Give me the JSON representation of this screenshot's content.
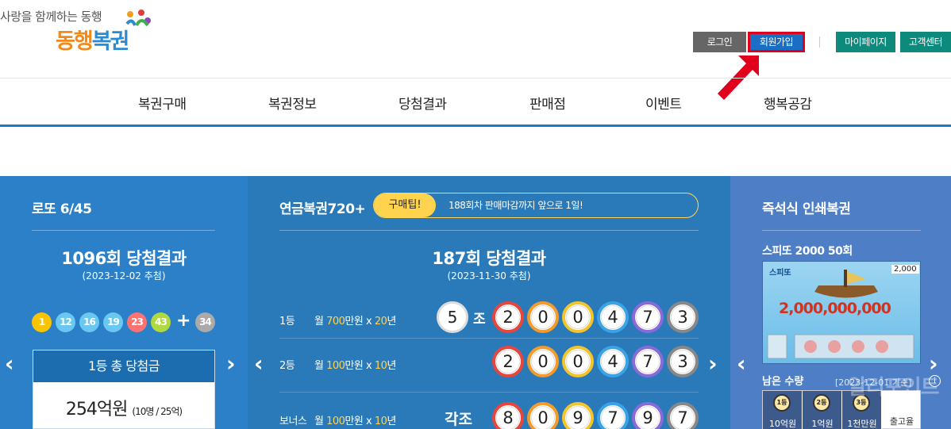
{
  "header": {
    "tagline": "사랑을 함께하는 동행",
    "logo": {
      "part1": "동행",
      "part2": "복권"
    },
    "util": {
      "login": "로그인",
      "join": "회원가입",
      "mypage": "마이페이지",
      "cs": "고객센터"
    },
    "colors": {
      "join_highlight": "#e0001b",
      "arrow": "#e0001b"
    }
  },
  "nav": {
    "items": [
      "복권구매",
      "복권정보",
      "당첨결과",
      "판매점",
      "이벤트",
      "행복공감"
    ]
  },
  "lotto": {
    "title": "로또 6/45",
    "draw_title": "1096회 당첨결과",
    "draw_date": "(2023-12-02 추첨)",
    "balls": [
      {
        "n": "1",
        "color": "#fbc400"
      },
      {
        "n": "12",
        "color": "#69c8f2"
      },
      {
        "n": "16",
        "color": "#69c8f2"
      },
      {
        "n": "19",
        "color": "#69c8f2"
      },
      {
        "n": "23",
        "color": "#ff7272"
      },
      {
        "n": "43",
        "color": "#b0d840"
      }
    ],
    "plus": "+",
    "bonus": {
      "n": "34",
      "color": "#aaaaaa"
    },
    "prize_head": "1등 총 당첨금",
    "prize_amount": "254억원",
    "prize_detail": "(10명 / 25억)"
  },
  "pension": {
    "title": "연금복권720+",
    "tip_label": "구매팁!",
    "tip_text": "188회차 판매마감까지 앞으로 1일!",
    "draw_title": "187회 당첨결과",
    "draw_date": "(2023-11-30 추첨)",
    "rank1": {
      "label": "1등",
      "pre": "월 ",
      "amt": "700",
      "mid": "만원 x ",
      "years": "20",
      "post": "년",
      "jo": "5",
      "jo_unit": "조",
      "digits": [
        "2",
        "0",
        "0",
        "4",
        "7",
        "3"
      ]
    },
    "rank2": {
      "label": "2등",
      "pre": "월 ",
      "amt": "100",
      "mid": "만원 x ",
      "years": "10",
      "post": "년",
      "digits": [
        "2",
        "0",
        "0",
        "4",
        "7",
        "3"
      ]
    },
    "bonus": {
      "label": "보너스",
      "pre": "월 ",
      "amt": "100",
      "mid": "만원 x ",
      "years": "10",
      "post": "년",
      "jo_text": "각조",
      "digits": [
        "8",
        "0",
        "9",
        "7",
        "9",
        "7"
      ]
    },
    "digit_colors": [
      "#e8453c",
      "#f49b2b",
      "#f4c52b",
      "#3aa3e8",
      "#8a6ad8",
      "#888888"
    ]
  },
  "instant": {
    "title": "즉석식 인쇄복권",
    "sub_title": "스피또 2000 50회",
    "ticket_brand": "스피또",
    "ticket_corner": "2,000",
    "ticket_big": "2,000,000,000",
    "remain": "남은 수량",
    "remain_date": "[2023-12-01 기준]",
    "info": "i",
    "tiers": [
      {
        "medal": "1등",
        "label": "10억원"
      },
      {
        "medal": "2등",
        "label": "1억원"
      },
      {
        "medal": "3등",
        "label": "1천만원"
      }
    ],
    "more": "출고율"
  },
  "watermark": "알리포인트"
}
